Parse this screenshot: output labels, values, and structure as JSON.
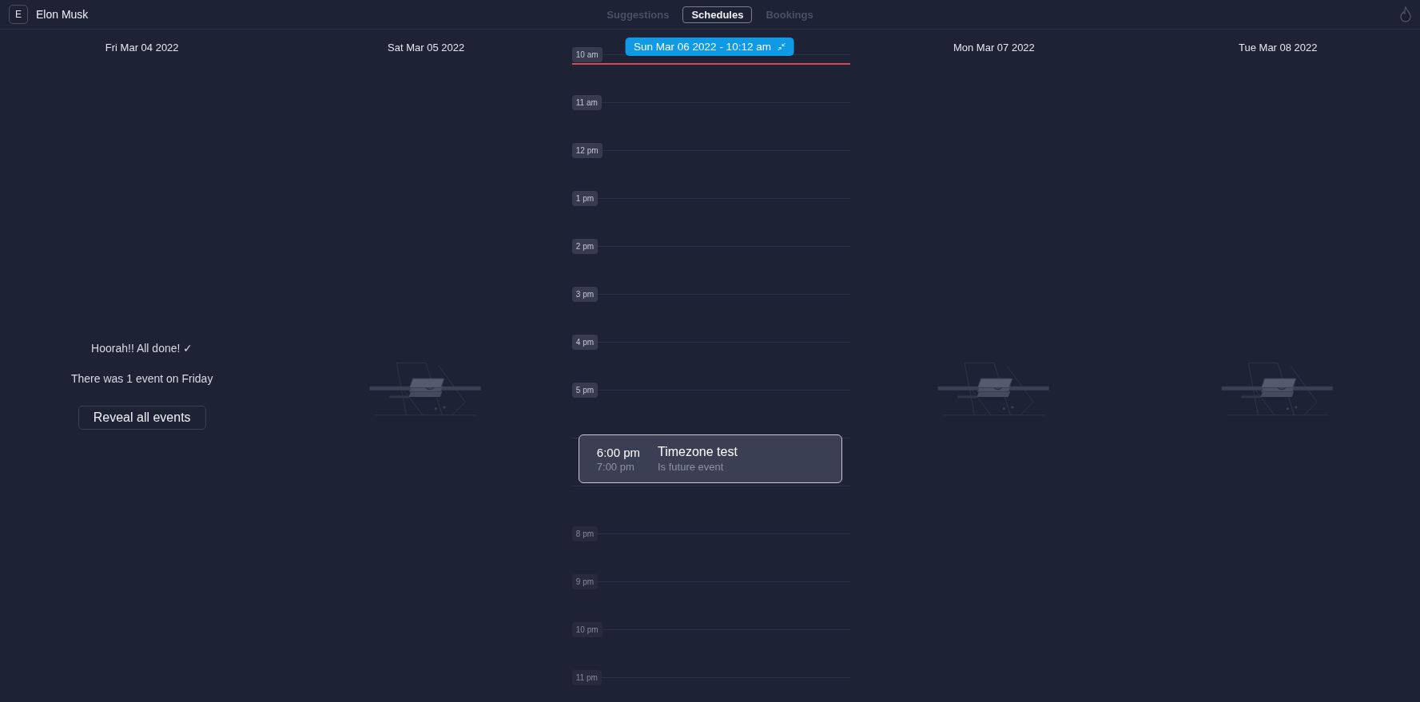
{
  "header": {
    "avatar": "E",
    "user": "Elon Musk",
    "tabs": [
      {
        "label": "Suggestions",
        "selected": false
      },
      {
        "label": "Schedules",
        "selected": true
      },
      {
        "label": "Bookings",
        "selected": false
      }
    ]
  },
  "days": [
    {
      "kind": "done",
      "date": "Fri Mar 04 2022",
      "message": "Hoorah!! All done! ✓",
      "summary": "There was 1 event on Friday",
      "button": "Reveal all events"
    },
    {
      "kind": "empty",
      "date": "Sat Mar 05 2022"
    },
    {
      "kind": "timeline",
      "date": "Sun Mar 06 2022 - 10:12 am",
      "hours": [
        {
          "label": "10 am",
          "dimmed": false,
          "covered": false
        },
        {
          "label": "11 am",
          "dimmed": false,
          "covered": false
        },
        {
          "label": "12 pm",
          "dimmed": false,
          "covered": false
        },
        {
          "label": "1 pm",
          "dimmed": false,
          "covered": false
        },
        {
          "label": "2 pm",
          "dimmed": false,
          "covered": false
        },
        {
          "label": "3 pm",
          "dimmed": false,
          "covered": false
        },
        {
          "label": "4 pm",
          "dimmed": false,
          "covered": false
        },
        {
          "label": "5 pm",
          "dimmed": false,
          "covered": false
        },
        {
          "covered": true,
          "event": {
            "start": "6:00 pm",
            "end": "7:00 pm",
            "title": "Timezone test",
            "note": "Is future event"
          }
        },
        {
          "covered": true
        },
        {
          "label": "8 pm",
          "dimmed": true,
          "covered": false
        },
        {
          "label": "9 pm",
          "dimmed": true,
          "covered": false
        },
        {
          "label": "10 pm",
          "dimmed": true,
          "covered": false
        },
        {
          "label": "11 pm",
          "dimmed": true,
          "covered": false
        }
      ]
    },
    {
      "kind": "empty",
      "date": "Mon Mar 07 2022"
    },
    {
      "kind": "empty",
      "date": "Tue Mar 08 2022"
    }
  ]
}
